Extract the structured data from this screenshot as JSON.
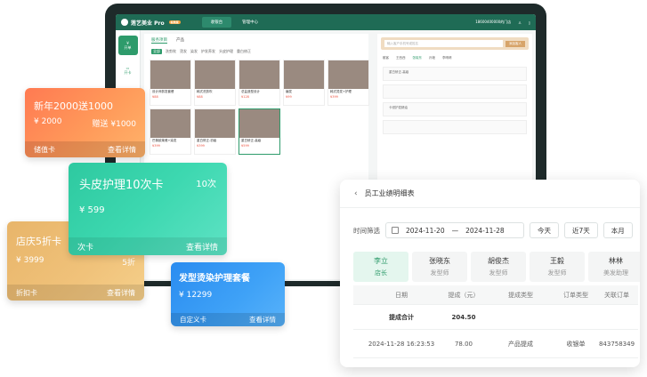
{
  "app": {
    "brand": "莲艺美业 Pro",
    "badge": "标准版",
    "nav": [
      "收银台",
      "管理中心"
    ],
    "phone": "18600400000",
    "store": "的门店",
    "sidebar": [
      "开单",
      "开卡"
    ]
  },
  "pos": {
    "tabs": [
      "服务项目",
      "产品"
    ],
    "categories": [
      "全部",
      "洗剪吹",
      "烫发",
      "染发",
      "护发养发",
      "头皮护理",
      "重白修正"
    ],
    "items": [
      {
        "name": "设计师剪发套餐",
        "price": "¥88"
      },
      {
        "name": "韩式洗剪吹",
        "price": "¥88"
      },
      {
        "name": "总监造型设计",
        "price": "¥128"
      },
      {
        "name": "编发",
        "price": "¥99"
      },
      {
        "name": "韩式烫发+护理",
        "price": "¥399"
      },
      {
        "name": "巴黎欧莱雅+染发",
        "price": "¥399"
      },
      {
        "name": "重白修正-初级",
        "price": "¥399"
      },
      {
        "name": "重白矫正-高级",
        "price": "¥599"
      }
    ],
    "search_placeholder": "输入客户手机号或姓名",
    "search_button": "添加客人",
    "filters": [
      "散客",
      "王西西",
      "张晓东",
      "孙艳",
      "李晴晴"
    ],
    "line_items": [
      "重白矫正-高级",
      "卡领护发精油"
    ]
  },
  "cards": {
    "stored": {
      "title": "新年2000送1000",
      "amount": "¥ 2000",
      "gift": "赠送 ¥1000",
      "kind": "储值卡",
      "more": "查看详情"
    },
    "discount": {
      "title": "店庆5折卡",
      "amount": "¥ 3999",
      "rate": "5折",
      "kind": "折扣卡",
      "more": "查看详情"
    },
    "times": {
      "title": "头皮护理10次卡",
      "count": "10次",
      "amount": "¥ 599",
      "kind": "次卡",
      "more": "查看详情"
    },
    "custom": {
      "title": "发型烫染护理套餐",
      "amount": "¥ 12299",
      "kind": "自定义卡",
      "more": "查看详情"
    }
  },
  "detail": {
    "title": "员工业绩明细表",
    "filter_label": "时间筛选",
    "date_from": "2024-11-20",
    "date_sep": "—",
    "date_to": "2024-11-28",
    "quick": [
      "今天",
      "近7天",
      "本月"
    ],
    "staff": [
      {
        "name": "李立",
        "role": "店长"
      },
      {
        "name": "张晓东",
        "role": "发型师"
      },
      {
        "name": "胡俊杰",
        "role": "发型师"
      },
      {
        "name": "王毅",
        "role": "发型师"
      },
      {
        "name": "林林",
        "role": "美发助理"
      }
    ],
    "columns": [
      "日期",
      "提成（元）",
      "提成类型",
      "订单类型",
      "关联订单"
    ],
    "summary": {
      "label": "提成合计",
      "value": "204.50"
    },
    "rows": [
      {
        "date": "2024-11-28 16:23:53",
        "amount": "78.00",
        "type": "产品提成",
        "order_type": "收银单",
        "order": "843758349"
      }
    ]
  }
}
